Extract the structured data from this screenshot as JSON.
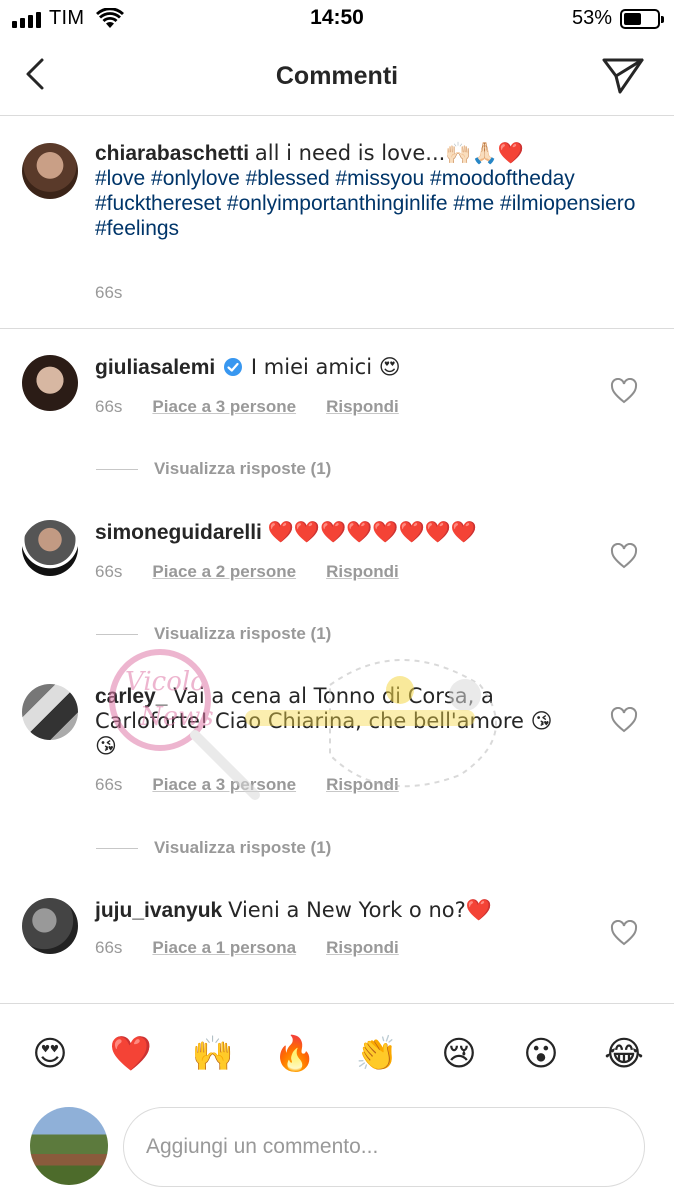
{
  "status_bar": {
    "carrier": "TIM",
    "time": "14:50",
    "battery": "53%",
    "battery_level": 0.53
  },
  "nav": {
    "title": "Commenti",
    "back_icon": "chevron-left-icon",
    "direct_icon": "paper-plane-icon"
  },
  "caption": {
    "username": "chiarabaschetti",
    "text": "all i need is love...🙌🏻🙏🏻❤️",
    "hashtags": "#love #onlylove #blessed #missyou #moodoftheday #fuckthereset #onlyimportanthinginlife #me #ilmiopensiero #feelings",
    "time": "66s"
  },
  "comments": [
    {
      "username": "giuliasalemi",
      "verified": true,
      "text": "I miei amici 😍",
      "time": "66s",
      "likes": "Piace a 3 persone",
      "reply": "Rispondi",
      "view_replies": "Visualizza risposte (1)"
    },
    {
      "username": "simoneguidarelli",
      "verified": false,
      "text": "❤️❤️❤️❤️❤️❤️❤️❤️",
      "time": "66s",
      "likes": "Piace a 2 persone",
      "reply": "Rispondi",
      "view_replies": "Visualizza risposte (1)"
    },
    {
      "username": "carley_",
      "verified": false,
      "text": "Vai a cena al Tonno di Corsa, a Carloforte! Ciao Chiarina, che bell'amore 😘😘",
      "time": "66s",
      "likes": "Piace a 3 persone",
      "reply": "Rispondi",
      "view_replies": "Visualizza risposte (1)"
    },
    {
      "username": "juju_ivanyuk",
      "verified": false,
      "text": "Vieni a New York o no?❤️",
      "time": "66s",
      "likes": "Piace a 1 persona",
      "reply": "Rispondi"
    }
  ],
  "quick_emojis": [
    "😍",
    "❤️",
    "🙌",
    "🔥",
    "👏",
    "😢",
    "😮",
    "😂"
  ],
  "composer": {
    "placeholder": "Aggiungi un commento..."
  },
  "watermark": {
    "text_line1": "Vicolo",
    "text_line2": "News"
  }
}
